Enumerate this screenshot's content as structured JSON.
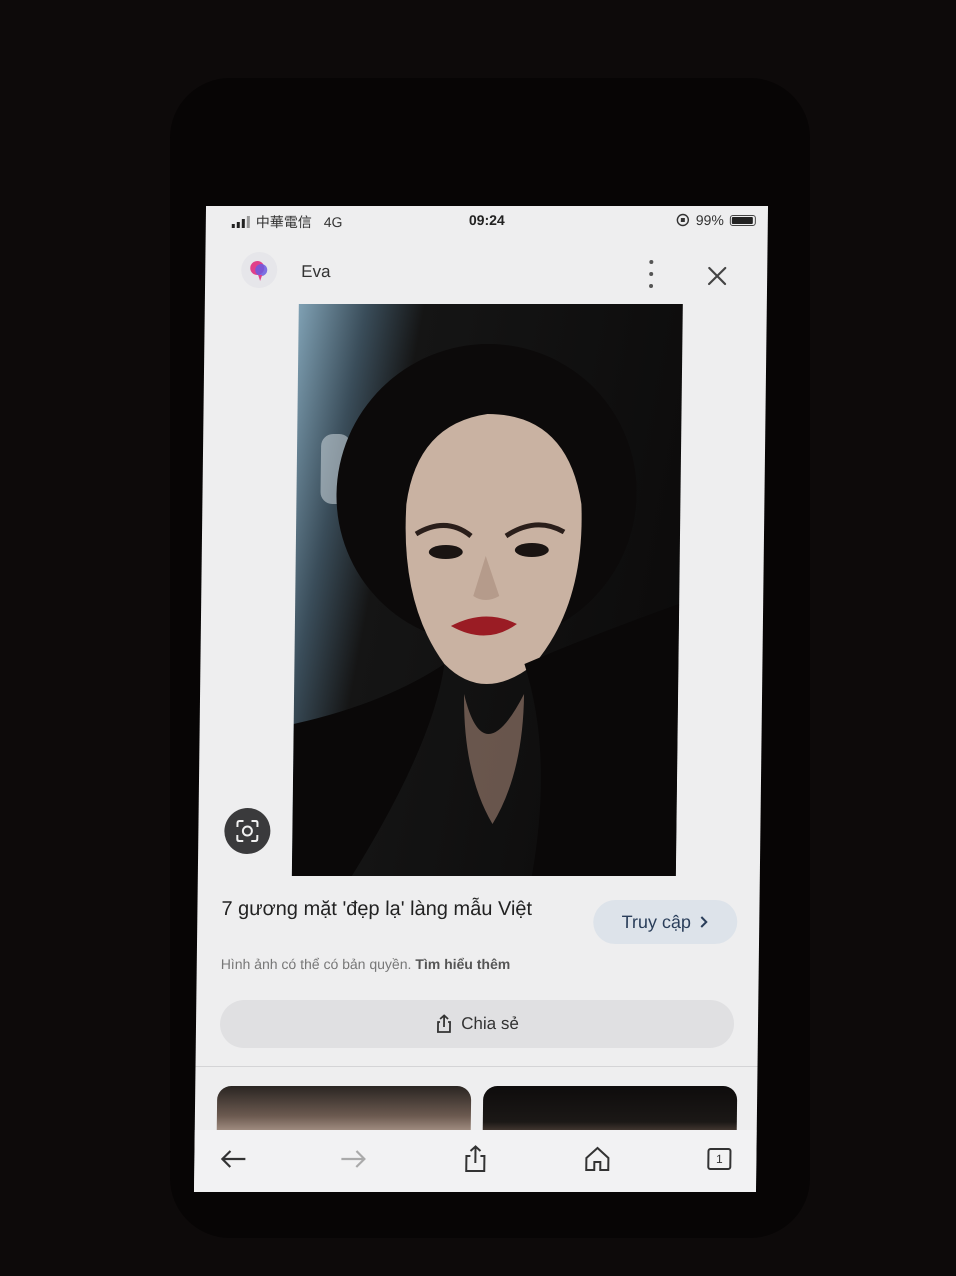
{
  "status_bar": {
    "carrier": "中華電信",
    "network": "4G",
    "time": "09:24",
    "battery": "99%",
    "battery_level": 0.99
  },
  "header": {
    "site_name": "Eva",
    "icons": [
      "eva-logo-icon",
      "more-vert-icon",
      "close-icon"
    ]
  },
  "image_panel": {
    "lens_icon": "google-lens-icon"
  },
  "caption": {
    "title": "7 gương mặt 'đẹp lạ' làng mẫu Việt",
    "visit_label": "Truy cập",
    "copyright_text": "Hình ảnh có thể có bản quyền.",
    "learn_more": "Tìm hiểu thêm",
    "share_label": "Chia sẻ"
  },
  "toolbar": {
    "tab_count": "1",
    "icons": [
      "back-arrow-icon",
      "forward-arrow-icon",
      "share-icon",
      "home-icon",
      "tabs-icon"
    ]
  },
  "colors": {
    "accent_button_bg": "#dde3ea",
    "accent_button_text": "#2a3e5a",
    "screen_bg": "#eeeeef"
  }
}
